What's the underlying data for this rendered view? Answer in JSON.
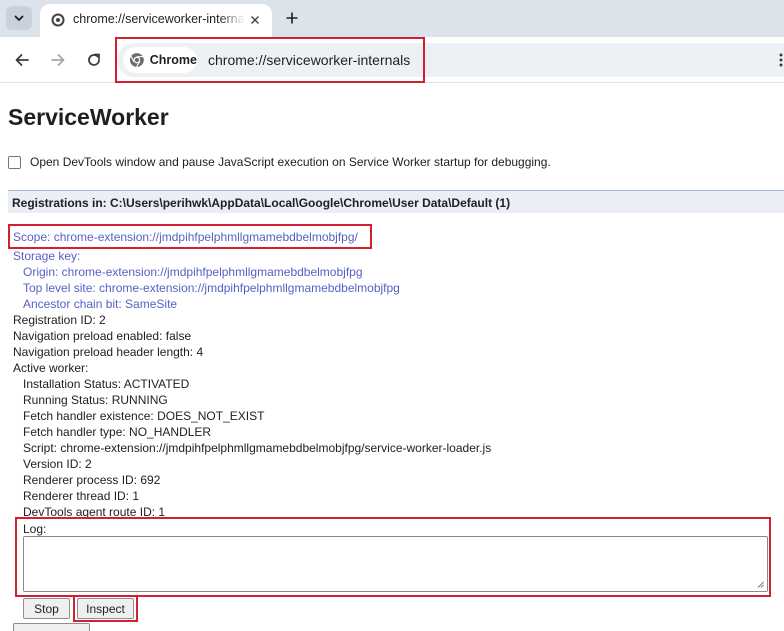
{
  "tab": {
    "title": "chrome://serviceworker-internals",
    "favicon": "chrome-settings-icon",
    "close_icon": "close-icon",
    "new_tab_icon": "plus-icon"
  },
  "toolbar": {
    "back_icon": "back-arrow-icon",
    "forward_icon": "forward-arrow-icon",
    "reload_icon": "reload-icon",
    "chip_label": "Chrome",
    "url": "chrome://serviceworker-internals"
  },
  "page": {
    "title": "ServiceWorker",
    "debug_option_label": "Open DevTools window and pause JavaScript execution on Service Worker startup for debugging.",
    "debug_option_checked": false
  },
  "registration": {
    "header": "Registrations in: C:\\Users\\perihwk\\AppData\\Local\\Google\\Chrome\\User Data\\Default (1)",
    "scope": "Scope: chrome-extension://jmdpihfpelphmllgmamebdbelmobjfpg/",
    "storage_key_label": "Storage key:",
    "origin": "Origin: chrome-extension://jmdpihfpelphmllgmamebdbelmobjfpg",
    "top_level_site": "Top level site: chrome-extension://jmdpihfpelphmllgmamebdbelmobjfpg",
    "ancestor_chain_bit": "Ancestor chain bit: SameSite",
    "registration_id": "Registration ID: 2",
    "nav_preload_enabled": "Navigation preload enabled: false",
    "nav_preload_header_length": "Navigation preload header length: 4",
    "active_worker_label": "Active worker:",
    "worker": {
      "installation_status": "Installation Status: ACTIVATED",
      "running_status": "Running Status: RUNNING",
      "fetch_handler_existence": "Fetch handler existence: DOES_NOT_EXIST",
      "fetch_handler_type": "Fetch handler type: NO_HANDLER",
      "script": "Script: chrome-extension://jmdpihfpelphmllgmamebdbelmobjfpg/service-worker-loader.js",
      "version_id": "Version ID: 2",
      "renderer_process_id": "Renderer process ID: 692",
      "renderer_thread_id": "Renderer thread ID: 1",
      "devtools_agent_route_id": "DevTools agent route ID: 1"
    },
    "log_label": "Log:",
    "log_value": "",
    "stop_label": "Stop",
    "inspect_label": "Inspect"
  },
  "colors": {
    "highlight": "#d32030",
    "link": "#5860c6",
    "header_bg": "#eaeef5",
    "tabstrip_bg": "#dde3ea"
  }
}
